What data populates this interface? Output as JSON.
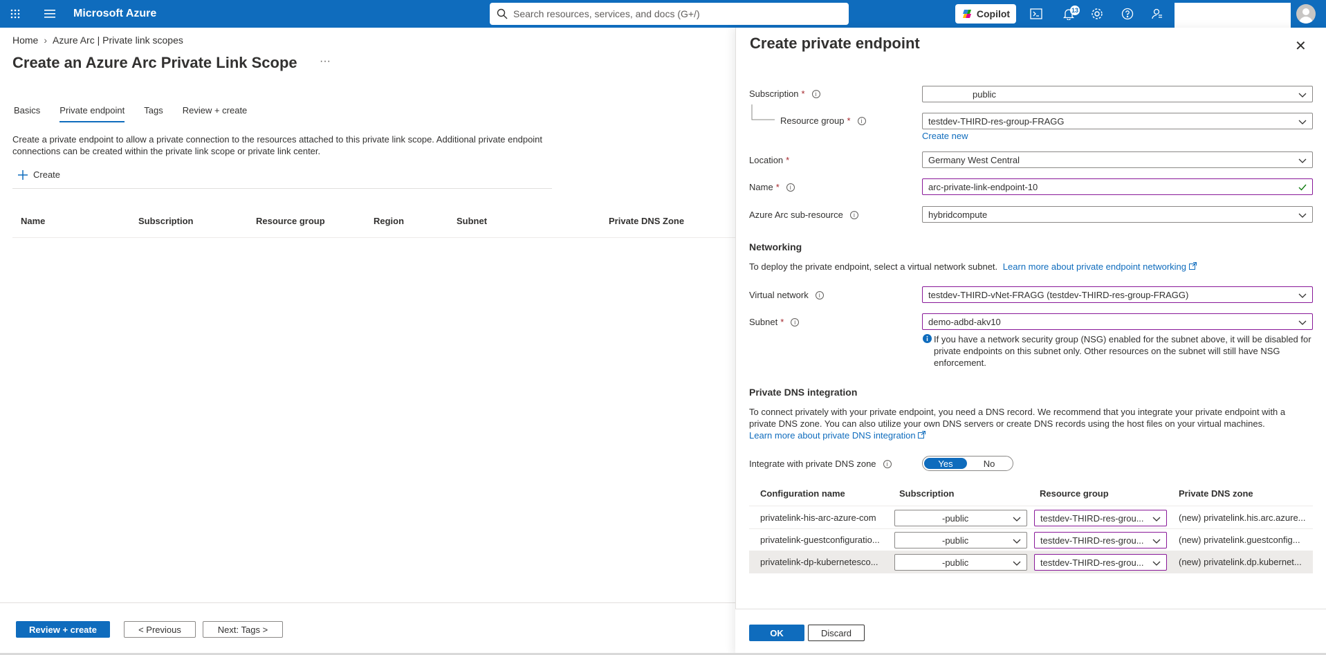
{
  "topbar": {
    "brand": "Microsoft Azure",
    "search_placeholder": "Search resources, services, and docs (G+/)",
    "copilot_label": "Copilot",
    "notification_count": "13"
  },
  "breadcrumb": {
    "home": "Home",
    "parent": "Azure Arc | Private link scopes"
  },
  "page": {
    "title": "Create an Azure Arc Private Link Scope",
    "tabs": [
      "Basics",
      "Private endpoint",
      "Tags",
      "Review + create"
    ],
    "active_tab": "Private endpoint",
    "description": "Create a private endpoint to allow a private connection to the resources attached to this private link scope. Additional private endpoint connections can be created within the private link scope or private link center.",
    "create_label": "Create",
    "table_headers": [
      "Name",
      "Subscription",
      "Resource group",
      "Region",
      "Subnet",
      "Private DNS Zone"
    ]
  },
  "footer": {
    "review_create": "Review + create",
    "previous": "< Previous",
    "next": "Next: Tags >"
  },
  "panel": {
    "title": "Create private endpoint",
    "subscription_label": "Subscription",
    "subscription_value": "public",
    "resource_group_label": "Resource group",
    "resource_group_value": "testdev-THIRD-res-group-FRAGG",
    "create_new": "Create new",
    "location_label": "Location",
    "location_value": "Germany West Central",
    "name_label": "Name",
    "name_value": "arc-private-link-endpoint-10",
    "subresource_label": "Azure Arc sub-resource",
    "subresource_value": "hybridcompute",
    "networking_header": "Networking",
    "networking_text": "To deploy the private endpoint, select a virtual network subnet.",
    "networking_link": "Learn more about private endpoint networking",
    "vnet_label": "Virtual network",
    "vnet_value": "testdev-THIRD-vNet-FRAGG (testdev-THIRD-res-group-FRAGG)",
    "subnet_label": "Subnet",
    "subnet_value": "demo-adbd-akv10",
    "nsg_info": "If you have a network security group (NSG) enabled for the subnet above, it will be disabled for private endpoints on this subnet only. Other resources on the subnet will still have NSG enforcement.",
    "dns_header": "Private DNS integration",
    "dns_text": "To connect privately with your private endpoint, you need a DNS record. We recommend that you integrate your private endpoint with a private DNS zone. You can also utilize your own DNS servers or create DNS records using the host files on your virtual machines.",
    "dns_link": "Learn more about private DNS integration",
    "integrate_label": "Integrate with private DNS zone",
    "toggle_yes": "Yes",
    "toggle_no": "No",
    "dns_columns": [
      "Configuration name",
      "Subscription",
      "Resource group",
      "Private DNS zone"
    ],
    "dns_rows": [
      {
        "config": "privatelink-his-arc-azure-com",
        "subscription": "-public",
        "resource_group": "testdev-THIRD-res-grou...",
        "zone": "(new) privatelink.his.arc.azure..."
      },
      {
        "config": "privatelink-guestconfiguratio...",
        "subscription": "-public",
        "resource_group": "testdev-THIRD-res-grou...",
        "zone": "(new) privatelink.guestconfig..."
      },
      {
        "config": "privatelink-dp-kubernetesco...",
        "subscription": "-public",
        "resource_group": "testdev-THIRD-res-grou...",
        "zone": "(new) privatelink.dp.kubernet..."
      }
    ],
    "ok": "OK",
    "discard": "Discard"
  },
  "colors": {
    "accent": "#0f6cbd",
    "focus_border": "#881798",
    "required": "#a4262c"
  }
}
